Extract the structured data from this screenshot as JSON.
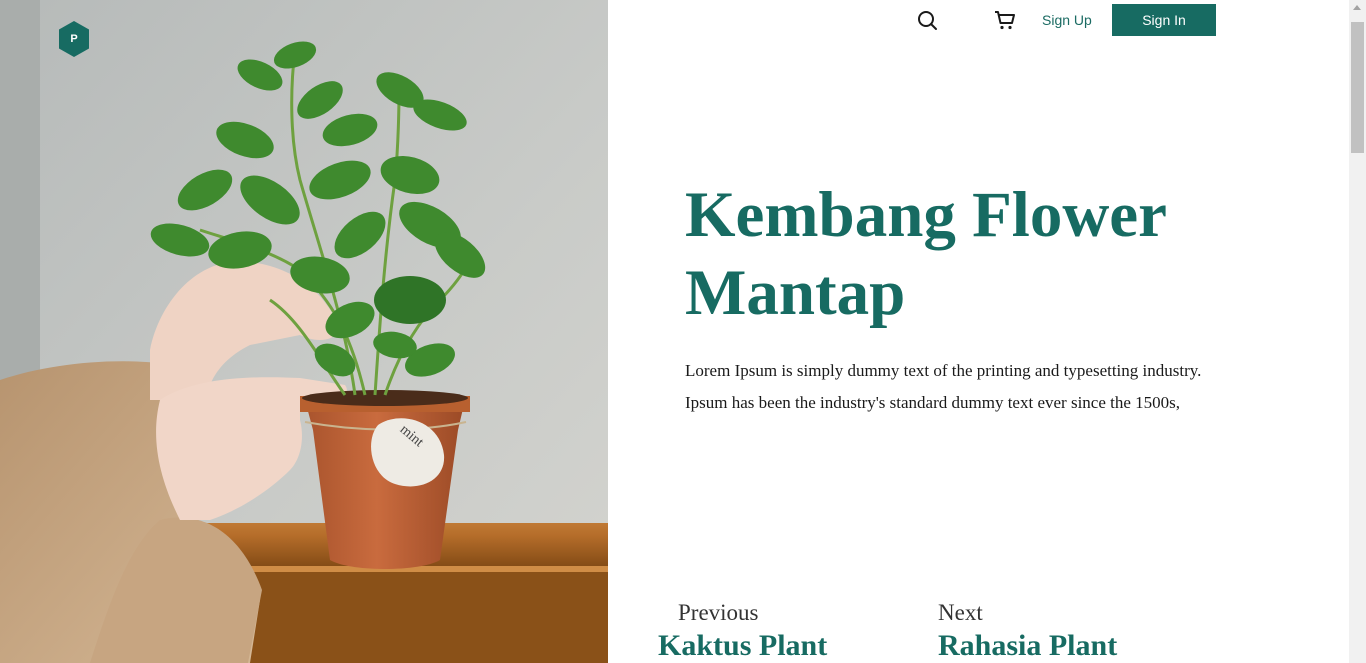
{
  "brand": {
    "logo_letter": "P",
    "color": "#176b62"
  },
  "nav": {
    "search_icon": "search-icon",
    "cart_icon": "cart-icon",
    "signup_label": "Sign Up",
    "signin_label": "Sign In"
  },
  "hero": {
    "title_line1": "Kembang Flower",
    "title_line2": "Mantap",
    "description": "Lorem Ipsum is simply dummy text of the printing and typesetting industry. Ipsum has been the industry's standard dummy text ever since the 1500s,",
    "tag_text": "mint"
  },
  "pager": {
    "previous_label": "Previous",
    "previous_title": "Kaktus Plant",
    "next_label": "Next",
    "next_title": "Rahasia Plant"
  },
  "colors": {
    "accent": "#176b62",
    "text": "#1a1a1a"
  }
}
